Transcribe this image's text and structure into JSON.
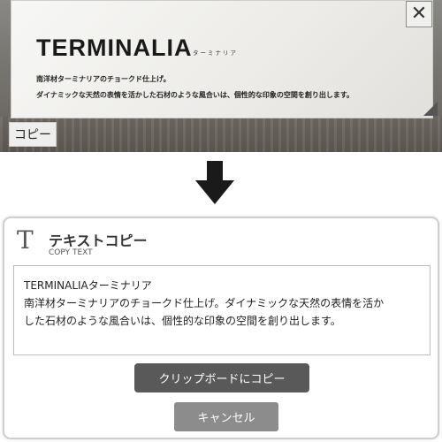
{
  "preview": {
    "brand_title": "TERMINALIA",
    "brand_kana": "ターミナリア",
    "description_line1": "南洋材ターミナリアのチョークド仕上げ。",
    "description_line2": "ダイナミックな天然の表情を活かした石材のような風合いは、個性的な印象の空間を創り出します。",
    "close_glyph": "✕",
    "copy_tab_label": "コピー"
  },
  "dialog": {
    "icon_glyph": "T",
    "title": "テキストコピー",
    "subtitle": "COPY TEXT",
    "text_lines": [
      "TERMINALIAターミナリア",
      "南洋材ターミナリアのチョークド仕上げ。ダイナミックな天然の表情を活か",
      "した石材のような風合いは、個性的な印象の空間を創り出します。"
    ],
    "copy_button_label": "クリップボードにコピー",
    "cancel_button_label": "キャンセル"
  },
  "colors": {
    "copy_button": "#595959",
    "cancel_button": "#8c8c8c",
    "arrow": "#1a1a1a"
  }
}
